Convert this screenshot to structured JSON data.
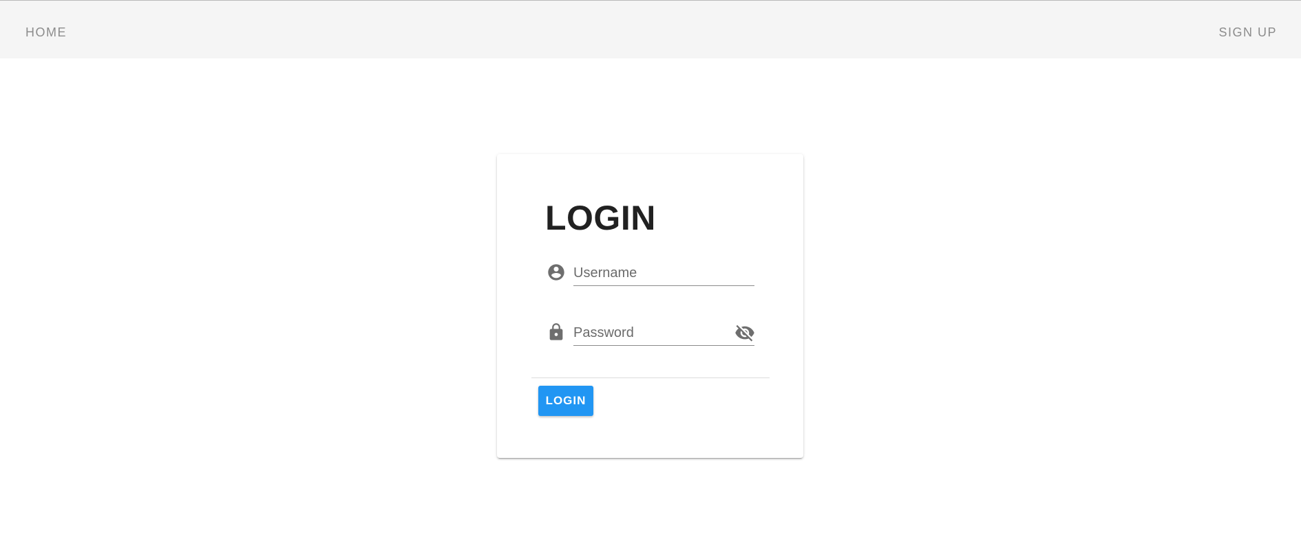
{
  "nav": {
    "home_label": "HOME",
    "signup_label": "SIGN UP"
  },
  "login_card": {
    "title": "LOGIN",
    "username": {
      "placeholder": "Username",
      "value": "",
      "icon": "account-circle-icon"
    },
    "password": {
      "placeholder": "Password",
      "value": "",
      "icon": "lock-icon",
      "toggle_icon": "eye-off-icon"
    },
    "submit_label": "LOGIN"
  },
  "colors": {
    "topbar_bg": "#f5f5f5",
    "nav_text": "#8c8c8c",
    "primary": "#2196f3",
    "title_text": "#212121",
    "icon": "#6e6e6e"
  }
}
